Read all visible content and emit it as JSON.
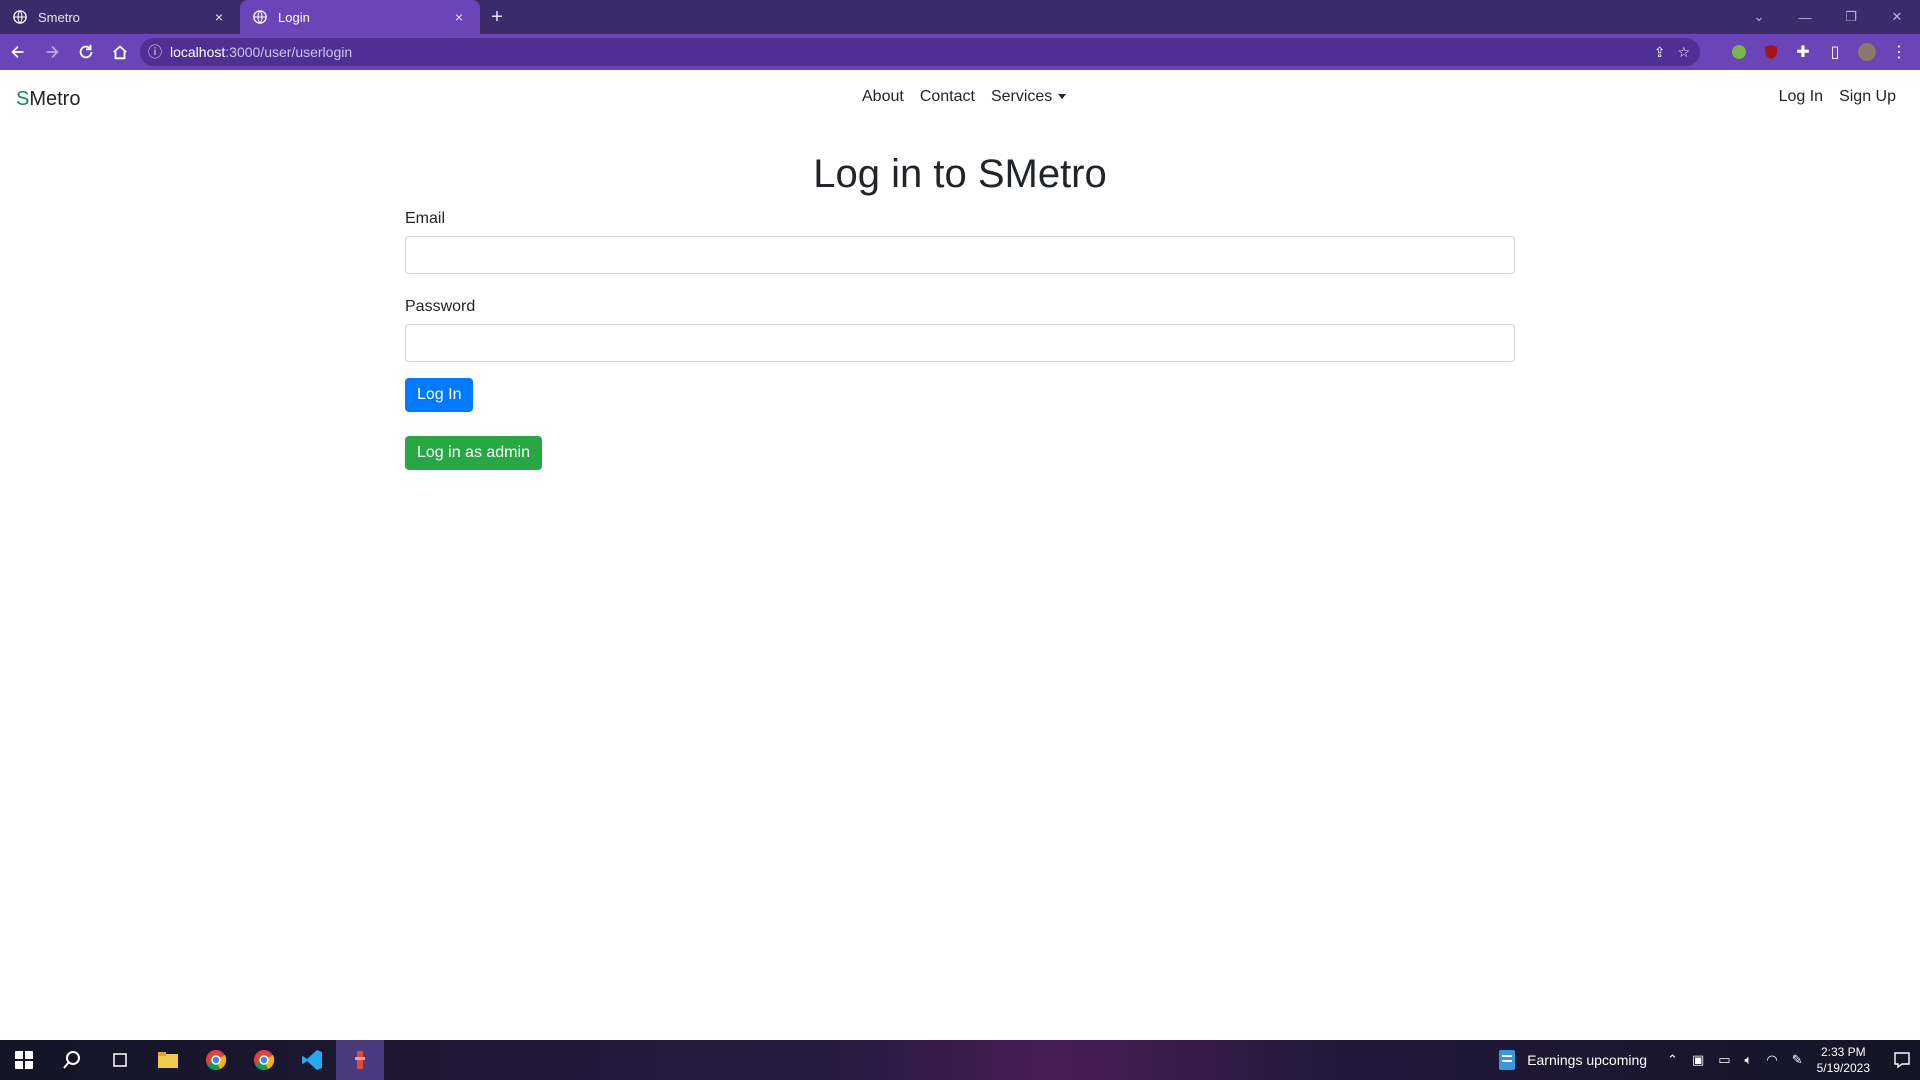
{
  "browser": {
    "tabs": [
      {
        "title": "Smetro",
        "active": false
      },
      {
        "title": "Login",
        "active": true
      }
    ],
    "url_host": "localhost",
    "url_path": ":3000/user/userlogin",
    "new_tab": "+",
    "close": "×"
  },
  "navbar": {
    "brand_s": "S",
    "brand_rest": "Metro",
    "links": {
      "about": "About",
      "contact": "Contact",
      "services": "Services"
    },
    "right": {
      "login": "Log In",
      "signup": "Sign Up"
    }
  },
  "main": {
    "title": "Log in to SMetro",
    "email_label": "Email",
    "password_label": "Password",
    "login_button": "Log In",
    "admin_button": "Log in as admin"
  },
  "taskbar": {
    "news": "Earnings upcoming",
    "time": "2:33 PM",
    "date": "5/19/2023"
  },
  "colors": {
    "tabbar": "#3d2a6b",
    "toolbar": "#6a45b8",
    "primary": "#007bff",
    "success": "#28a745",
    "brand_green": "#198754"
  }
}
